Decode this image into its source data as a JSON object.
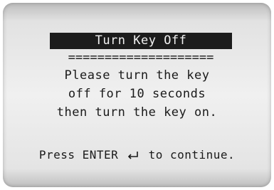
{
  "screen": {
    "title": "Turn Key Off",
    "separator": "====================",
    "message_lines": [
      "Please turn the key",
      "off for 10 seconds",
      "then turn the key on."
    ],
    "footer": {
      "before_icon": "Press ENTER",
      "icon": "enter-return-icon",
      "after_icon": "to continue."
    }
  },
  "colors": {
    "title_bar_bg": "#1c1c1c",
    "title_text": "#f2f2f2",
    "text": "#1a1a1a",
    "screen_bg": "#f0f0f0"
  }
}
